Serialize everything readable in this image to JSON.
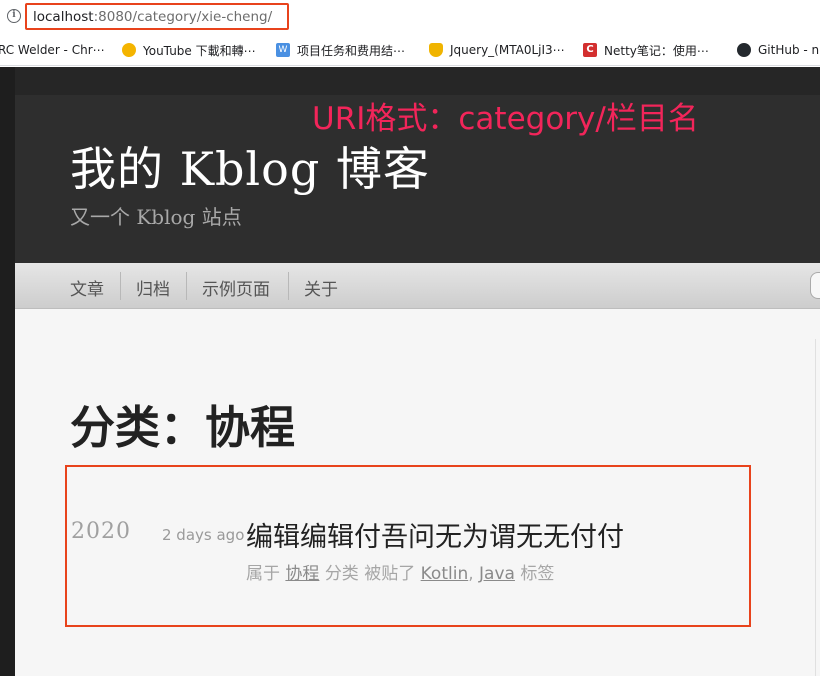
{
  "browser": {
    "url_host": "localhost",
    "url_path": ":8080/category/xie-cheng/",
    "info_icon": "info-icon"
  },
  "bookmarks": [
    {
      "label": "RC Welder - Chr⋯",
      "icon": "welder-icon",
      "color": "#9e9e9e"
    },
    {
      "label": "YouTube 下載和轉⋯",
      "icon": "youtube-download-icon",
      "color": "#f4b400"
    },
    {
      "label": "项目任务和费用结⋯",
      "icon": "doc-w-icon",
      "color": "#4a90e2"
    },
    {
      "label": "Jquery_(MTA0LjI3⋯",
      "icon": "trophy-icon",
      "color": "#f0b400"
    },
    {
      "label": "Netty笔记：使用⋯",
      "icon": "c-logo-icon",
      "color": "#d32f2f"
    },
    {
      "label": "GitHub - nu",
      "icon": "github-icon",
      "color": "#24292e"
    }
  ],
  "annotation": {
    "text": "URI格式：category/栏目名",
    "color": "#f2255a"
  },
  "site": {
    "title": "我的 Kblog 博客",
    "description": "又一个 Kblog 站点"
  },
  "nav": {
    "items": [
      "文章",
      "归档",
      "示例页面",
      "关于"
    ]
  },
  "page": {
    "title": "分类：协程"
  },
  "post": {
    "year": "2020",
    "relative_date": "2 days ago",
    "title": "编辑编辑付吾问无为谓无无付付",
    "meta_prefix": "属于",
    "category": "协程",
    "meta_middle": "分类 被贴了",
    "tag1": "Kotlin",
    "comma": ",",
    "tag2": "Java",
    "meta_suffix": "标签"
  },
  "colors": {
    "highlight_box": "#e8431c",
    "header_bg": "#2e2e2e"
  }
}
